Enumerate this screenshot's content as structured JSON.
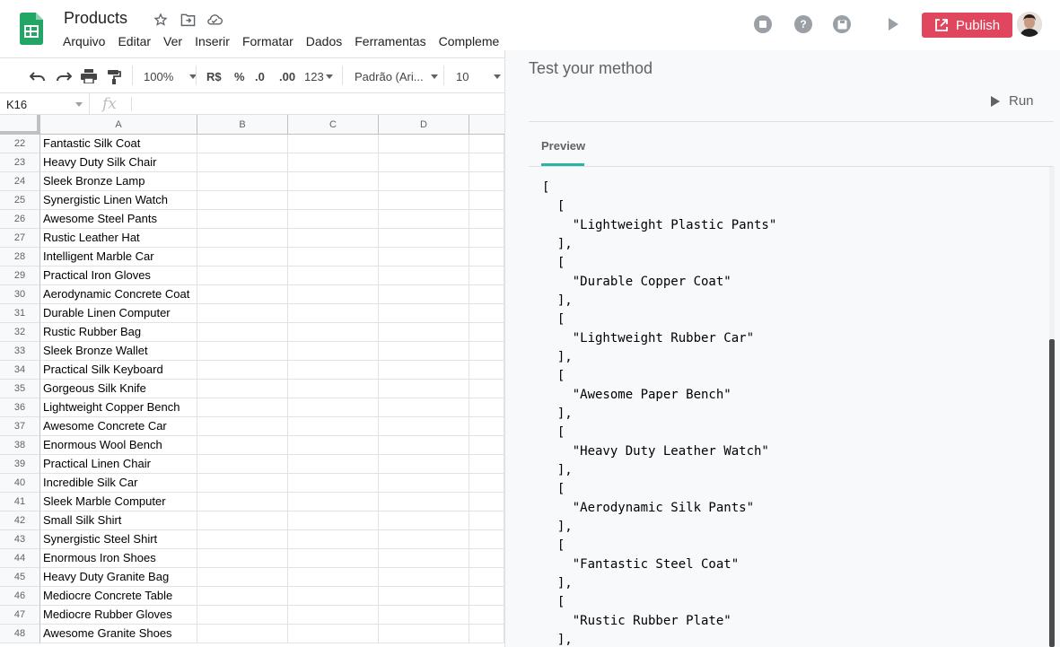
{
  "app": {
    "title": "Products",
    "menu": [
      "Arquivo",
      "Editar",
      "Ver",
      "Inserir",
      "Formatar",
      "Dados",
      "Ferramentas",
      "Compleme"
    ]
  },
  "topbar": {
    "publish_label": "Publish",
    "accent_color": "#e0465e"
  },
  "toolbar": {
    "zoom": "100%",
    "currency": "R$",
    "percent": "%",
    "decrease_decimals": ".0",
    "increase_decimals": ".00",
    "more_formats": "123",
    "font": "Padrão (Ari...",
    "font_size": "10"
  },
  "formula_bar": {
    "cell_ref": "K16",
    "fx": "fx"
  },
  "grid": {
    "columns": [
      "A",
      "B",
      "C",
      "D"
    ],
    "rows": [
      {
        "n": "22",
        "a": "Fantastic Silk Coat"
      },
      {
        "n": "23",
        "a": "Heavy Duty Silk Chair"
      },
      {
        "n": "24",
        "a": "Sleek Bronze Lamp"
      },
      {
        "n": "25",
        "a": "Synergistic Linen Watch"
      },
      {
        "n": "26",
        "a": "Awesome Steel Pants"
      },
      {
        "n": "27",
        "a": "Rustic Leather Hat"
      },
      {
        "n": "28",
        "a": "Intelligent Marble Car"
      },
      {
        "n": "29",
        "a": "Practical Iron Gloves"
      },
      {
        "n": "30",
        "a": "Aerodynamic Concrete Coat"
      },
      {
        "n": "31",
        "a": "Durable Linen Computer"
      },
      {
        "n": "32",
        "a": "Rustic Rubber Bag"
      },
      {
        "n": "33",
        "a": "Sleek Bronze Wallet"
      },
      {
        "n": "34",
        "a": "Practical Silk Keyboard"
      },
      {
        "n": "35",
        "a": "Gorgeous Silk Knife"
      },
      {
        "n": "36",
        "a": "Lightweight Copper Bench"
      },
      {
        "n": "37",
        "a": "Awesome Concrete Car"
      },
      {
        "n": "38",
        "a": "Enormous Wool Bench"
      },
      {
        "n": "39",
        "a": "Practical Linen Chair"
      },
      {
        "n": "40",
        "a": "Incredible Silk Car"
      },
      {
        "n": "41",
        "a": "Sleek Marble Computer"
      },
      {
        "n": "42",
        "a": "Small Silk Shirt"
      },
      {
        "n": "43",
        "a": "Synergistic Steel Shirt"
      },
      {
        "n": "44",
        "a": "Enormous Iron Shoes"
      },
      {
        "n": "45",
        "a": "Heavy Duty Granite Bag"
      },
      {
        "n": "46",
        "a": "Mediocre Concrete Table"
      },
      {
        "n": "47",
        "a": "Mediocre Rubber Gloves"
      },
      {
        "n": "48",
        "a": "Awesome Granite Shoes"
      }
    ]
  },
  "panel": {
    "title": "Test your method",
    "run_label": "Run",
    "tab_preview": "Preview",
    "tab_color": "#26b5a6",
    "preview_code": "[\n  [\n    \"Lightweight Plastic Pants\"\n  ],\n  [\n    \"Durable Copper Coat\"\n  ],\n  [\n    \"Lightweight Rubber Car\"\n  ],\n  [\n    \"Awesome Paper Bench\"\n  ],\n  [\n    \"Heavy Duty Leather Watch\"\n  ],\n  [\n    \"Aerodynamic Silk Pants\"\n  ],\n  [\n    \"Fantastic Steel Coat\"\n  ],\n  [\n    \"Rustic Rubber Plate\"\n  ],"
  }
}
